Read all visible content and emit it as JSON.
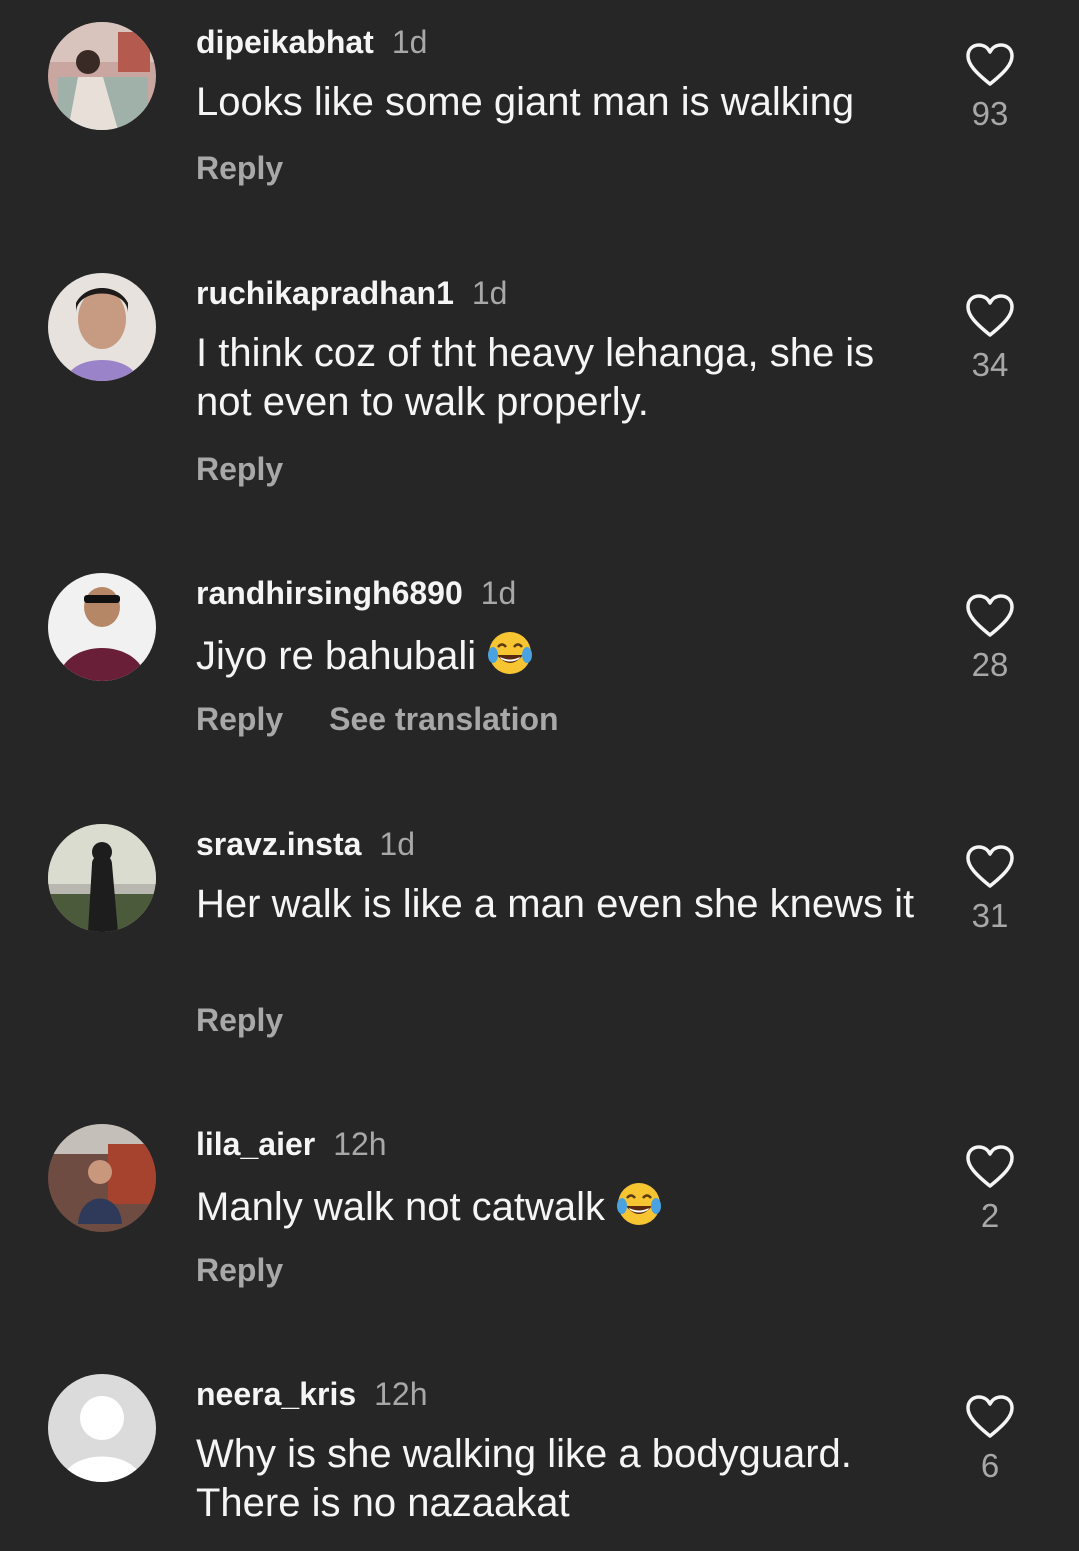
{
  "comments": [
    {
      "username": "dipeikabhat",
      "time": "1d",
      "text": "Looks like some giant man is walking",
      "reply": "Reply",
      "likes": "93",
      "avatar_icon": "user-photo-avatar"
    },
    {
      "username": "ruchikapradhan1",
      "time": "1d",
      "text": "I think coz of tht heavy lehanga, she is not even to walk properly.",
      "reply": "Reply",
      "likes": "34",
      "avatar_icon": "user-photo-avatar"
    },
    {
      "username": "randhirsingh6890",
      "time": "1d",
      "text": "Jiyo re bahubali",
      "reply": "Reply",
      "see_translation": "See translation",
      "likes": "28",
      "avatar_icon": "user-photo-avatar",
      "emoji": "tears-of-joy-emoji"
    },
    {
      "username": "sravz.insta",
      "time": "1d",
      "text": "Her walk is like a man even she knews it",
      "reply": "Reply",
      "likes": "31",
      "avatar_icon": "user-photo-avatar"
    },
    {
      "username": "lila_aier",
      "time": "12h",
      "text": "Manly walk not catwalk",
      "reply": "Reply",
      "likes": "2",
      "avatar_icon": "user-photo-avatar",
      "emoji": "tears-of-joy-emoji"
    },
    {
      "username": "neera_kris",
      "time": "12h",
      "text": "Why is she walking like a bodyguard. There is no nazaakat",
      "likes": "6",
      "avatar_icon": "default-avatar"
    }
  ],
  "icons": {
    "like": "heart-outline-icon"
  },
  "colors": {
    "background": "#262626",
    "primary_text": "#f5f5f5",
    "secondary_text": "#a8a8a8"
  }
}
